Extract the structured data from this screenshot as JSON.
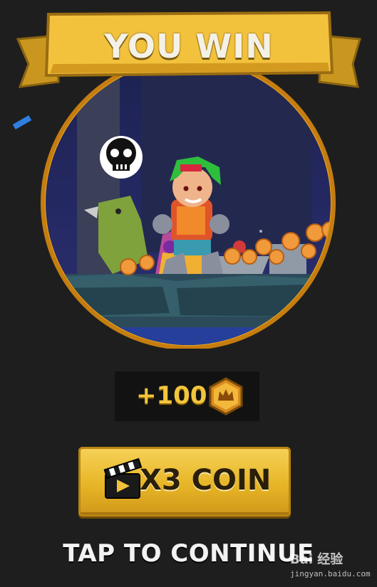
{
  "banner": {
    "title": "YOU WIN"
  },
  "reward": {
    "amount_text": "+100",
    "coin_icon": "crown-coin-icon"
  },
  "x3_button": {
    "label": "X3 COIN",
    "icon": "clapperboard-play-icon"
  },
  "continue": {
    "label": "TAP TO CONTINUE"
  },
  "watermark": {
    "brand": "Bai 经验",
    "url": "jingyan.baidu.com"
  },
  "colors": {
    "gold": "#f2c53d",
    "background": "#1e1e1e",
    "button": "#e7b526"
  }
}
